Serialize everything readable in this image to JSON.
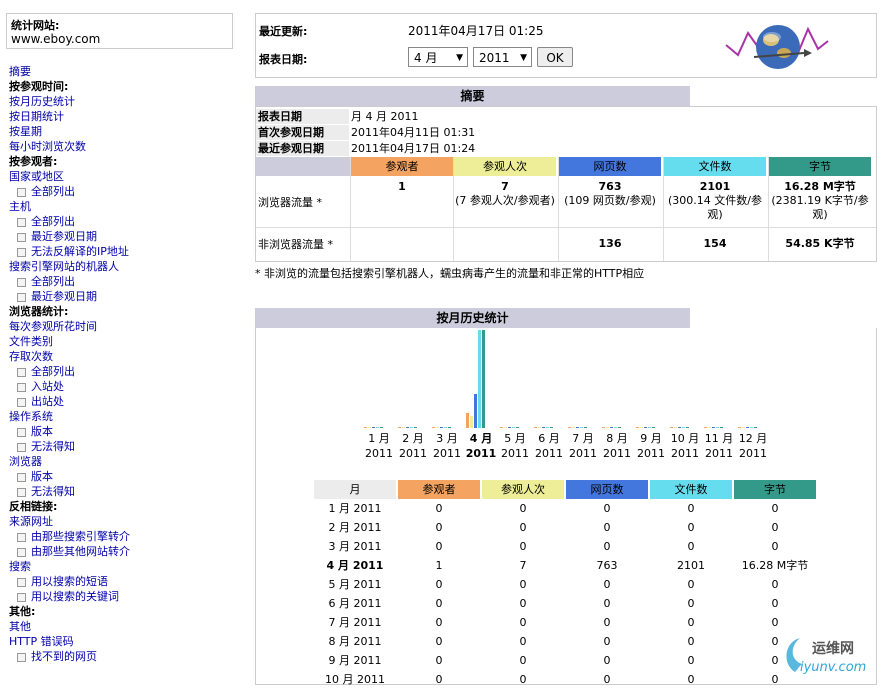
{
  "site": {
    "title": "统计网站:",
    "domain": "www.eboy.com"
  },
  "sidebar": [
    {
      "label": "摘要",
      "kind": "l"
    },
    {
      "label": "按参观时间:",
      "kind": "h"
    },
    {
      "label": "按月历史统计",
      "kind": "l"
    },
    {
      "label": "按日期统计",
      "kind": "l"
    },
    {
      "label": "按星期",
      "kind": "l"
    },
    {
      "label": "每小时浏览次数",
      "kind": "l"
    },
    {
      "label": "按参观者:",
      "kind": "h"
    },
    {
      "label": "国家或地区",
      "kind": "l"
    },
    {
      "label": "全部列出",
      "kind": "s"
    },
    {
      "label": "主机",
      "kind": "l"
    },
    {
      "label": "全部列出",
      "kind": "s"
    },
    {
      "label": "最近参观日期",
      "kind": "s"
    },
    {
      "label": "无法反解译的IP地址",
      "kind": "s"
    },
    {
      "label": "搜索引擎网站的机器人",
      "kind": "l"
    },
    {
      "label": "全部列出",
      "kind": "s"
    },
    {
      "label": "最近参观日期",
      "kind": "s"
    },
    {
      "label": "浏览器统计:",
      "kind": "h"
    },
    {
      "label": "每次参观所花时间",
      "kind": "l"
    },
    {
      "label": "文件类别",
      "kind": "l"
    },
    {
      "label": "存取次数",
      "kind": "l"
    },
    {
      "label": "全部列出",
      "kind": "s"
    },
    {
      "label": "入站处",
      "kind": "s"
    },
    {
      "label": "出站处",
      "kind": "s"
    },
    {
      "label": "操作系统",
      "kind": "l"
    },
    {
      "label": "版本",
      "kind": "s"
    },
    {
      "label": "无法得知",
      "kind": "s"
    },
    {
      "label": "浏览器",
      "kind": "l"
    },
    {
      "label": "版本",
      "kind": "s"
    },
    {
      "label": "无法得知",
      "kind": "s"
    },
    {
      "label": "反相链接:",
      "kind": "h"
    },
    {
      "label": "来源网址",
      "kind": "l"
    },
    {
      "label": "由那些搜索引擎转介",
      "kind": "s"
    },
    {
      "label": "由那些其他网站转介",
      "kind": "s"
    },
    {
      "label": "搜索",
      "kind": "l"
    },
    {
      "label": "用以搜索的短语",
      "kind": "s"
    },
    {
      "label": "用以搜索的关键词",
      "kind": "s"
    },
    {
      "label": "其他:",
      "kind": "h"
    },
    {
      "label": "其他",
      "kind": "l"
    },
    {
      "label": "HTTP 错误码",
      "kind": "l"
    },
    {
      "label": "找不到的网页",
      "kind": "s"
    }
  ],
  "header": {
    "last_update_label": "最近更新:",
    "last_update_value": "2011年04月17日 01:25",
    "report_date_label": "报表日期:",
    "month_value": "4 月",
    "year_value": "2011",
    "ok_label": "OK"
  },
  "summary": {
    "title": "摘要",
    "report_date_label": "报表日期",
    "report_date_value": "月 4 月 2011",
    "first_visit_label": "首次参观日期",
    "first_visit_value": "2011年04月11日 01:31",
    "last_visit_label": "最近参观日期",
    "last_visit_value": "2011年04月17日 01:24",
    "columns": [
      "参观者",
      "参观人次",
      "网页数",
      "文件数",
      "字节"
    ],
    "column_colors": [
      "#f4a460",
      "#eeee99",
      "#4477dd",
      "#66ddee",
      "#339988"
    ],
    "browser_label": "浏览器流量 *",
    "browser_values": [
      "1",
      "7",
      "763",
      "2101",
      "16.28 M字节"
    ],
    "browser_sub": [
      "",
      "(7 参观人次/参观者)",
      "(109 网页数/参观)",
      "(300.14 文件数/参观)",
      "(2381.19 K字节/参观)"
    ],
    "nonbrowser_label": "非浏览器流量 *",
    "nonbrowser_values": [
      "",
      "",
      "136",
      "154",
      "54.85 K字节"
    ],
    "note": "* 非浏览的流量包括搜索引擎机器人，蠕虫病毒产生的流量和非正常的HTTP相应"
  },
  "monthly": {
    "title": "按月历史统计",
    "months": [
      "1 月",
      "2 月",
      "3 月",
      "4 月",
      "5 月",
      "6 月",
      "7 月",
      "8 月",
      "9 月",
      "10 月",
      "11 月",
      "12 月"
    ],
    "year": "2011",
    "current_index": 3,
    "table_headers": [
      "月",
      "参观者",
      "参观人次",
      "网页数",
      "文件数",
      "字节"
    ],
    "rows": [
      [
        "1 月 2011",
        "0",
        "0",
        "0",
        "0",
        "0"
      ],
      [
        "2 月 2011",
        "0",
        "0",
        "0",
        "0",
        "0"
      ],
      [
        "3 月 2011",
        "0",
        "0",
        "0",
        "0",
        "0"
      ],
      [
        "4 月 2011",
        "1",
        "7",
        "763",
        "2101",
        "16.28 M字节"
      ],
      [
        "5 月 2011",
        "0",
        "0",
        "0",
        "0",
        "0"
      ],
      [
        "6 月 2011",
        "0",
        "0",
        "0",
        "0",
        "0"
      ],
      [
        "7 月 2011",
        "0",
        "0",
        "0",
        "0",
        "0"
      ],
      [
        "8 月 2011",
        "0",
        "0",
        "0",
        "0",
        "0"
      ],
      [
        "9 月 2011",
        "0",
        "0",
        "0",
        "0",
        "0"
      ],
      [
        "10 月 2011",
        "0",
        "0",
        "0",
        "0",
        "0"
      ]
    ]
  },
  "chart_data": {
    "type": "bar",
    "categories": [
      "1 月",
      "2 月",
      "3 月",
      "4 月",
      "5 月",
      "6 月",
      "7 月",
      "8 月",
      "9 月",
      "10 月",
      "11 月",
      "12 月"
    ],
    "series": [
      {
        "name": "参观者",
        "values": [
          0,
          0,
          0,
          1,
          0,
          0,
          0,
          0,
          0,
          0,
          0,
          0
        ]
      },
      {
        "name": "参观人次",
        "values": [
          0,
          0,
          0,
          7,
          0,
          0,
          0,
          0,
          0,
          0,
          0,
          0
        ]
      },
      {
        "name": "网页数",
        "values": [
          0,
          0,
          0,
          763,
          0,
          0,
          0,
          0,
          0,
          0,
          0,
          0
        ]
      },
      {
        "name": "文件数",
        "values": [
          0,
          0,
          0,
          2101,
          0,
          0,
          0,
          0,
          0,
          0,
          0,
          0
        ]
      },
      {
        "name": "字节",
        "values": [
          0,
          0,
          0,
          16.28,
          0,
          0,
          0,
          0,
          0,
          0,
          0,
          0
        ]
      }
    ]
  },
  "watermark": {
    "cn": "运维网",
    "en": "iyunv.com"
  }
}
